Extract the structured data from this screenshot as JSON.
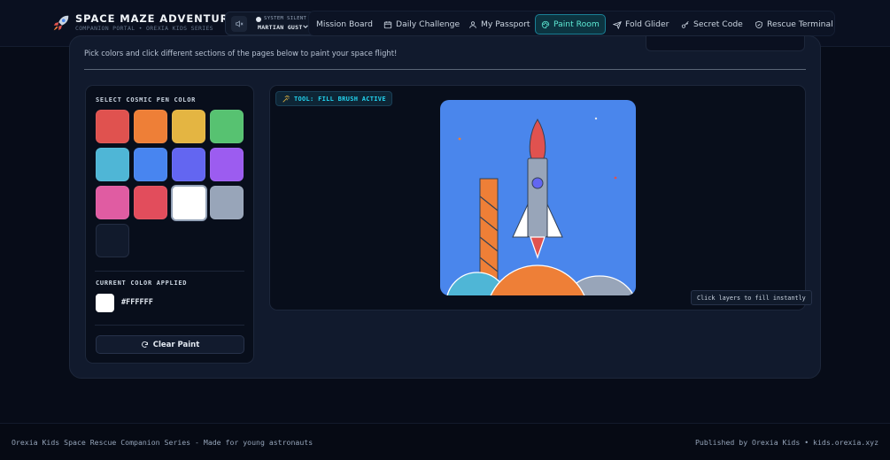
{
  "brand": {
    "title": "SPACE MAZE ADVENTURE",
    "subtitle": "COMPANION PORTAL • OREXIA KIDS SERIES",
    "logo_icon": "rocket-icon"
  },
  "status": {
    "label": "SYSTEM SILENT",
    "user": "MARTIAN GUST",
    "mute_icon": "speaker-muted-icon"
  },
  "nav": {
    "items": [
      {
        "label": "Mission Board",
        "icon": "none"
      },
      {
        "label": "Daily Challenge",
        "icon": "calendar-icon"
      },
      {
        "label": "My Passport",
        "icon": "user-icon"
      },
      {
        "label": "Paint Room",
        "icon": "palette-icon",
        "active": true
      },
      {
        "label": "Fold Glider",
        "icon": "paper-plane-icon"
      },
      {
        "label": "Secret Code",
        "icon": "key-icon"
      },
      {
        "label": "Rescue Terminal",
        "icon": "shield-icon"
      }
    ]
  },
  "instructions": "Pick colors and click different sections of the pages below to paint your space flight!",
  "palette": {
    "title": "SELECT COSMIC PEN COLOR",
    "swatches": [
      "#e0524f",
      "#ee7f37",
      "#e4b542",
      "#57c271",
      "#4fb6d6",
      "#4885f0",
      "#6366f1",
      "#9c5cf0",
      "#e05ca2",
      "#e24d5c",
      "#ffffff",
      "#98a5b9",
      "#111a2c"
    ],
    "selected": "#FFFFFF",
    "current_label": "CURRENT COLOR APPLIED",
    "current_value": "#FFFFFF",
    "clear_label": "Clear Paint"
  },
  "canvas": {
    "tool_label": "TOOL: FILL BRUSH ACTIVE",
    "hint": "Click layers to fill instantly",
    "colors": {
      "sky": "#4a86ec",
      "flame": "#e0524f",
      "body": "#98a5b9",
      "fins": "#ffffff",
      "window": "#6366f1",
      "tower": "#ee7f37",
      "hill_left": "#4fb6d6",
      "hill_mid": "#ee7f37",
      "hill_right": "#98a5b9"
    }
  },
  "footer": {
    "left": "Orexia Kids Space Rescue Companion Series - Made for young astronauts",
    "right": "Published by Orexia Kids • kids.orexia.xyz"
  }
}
